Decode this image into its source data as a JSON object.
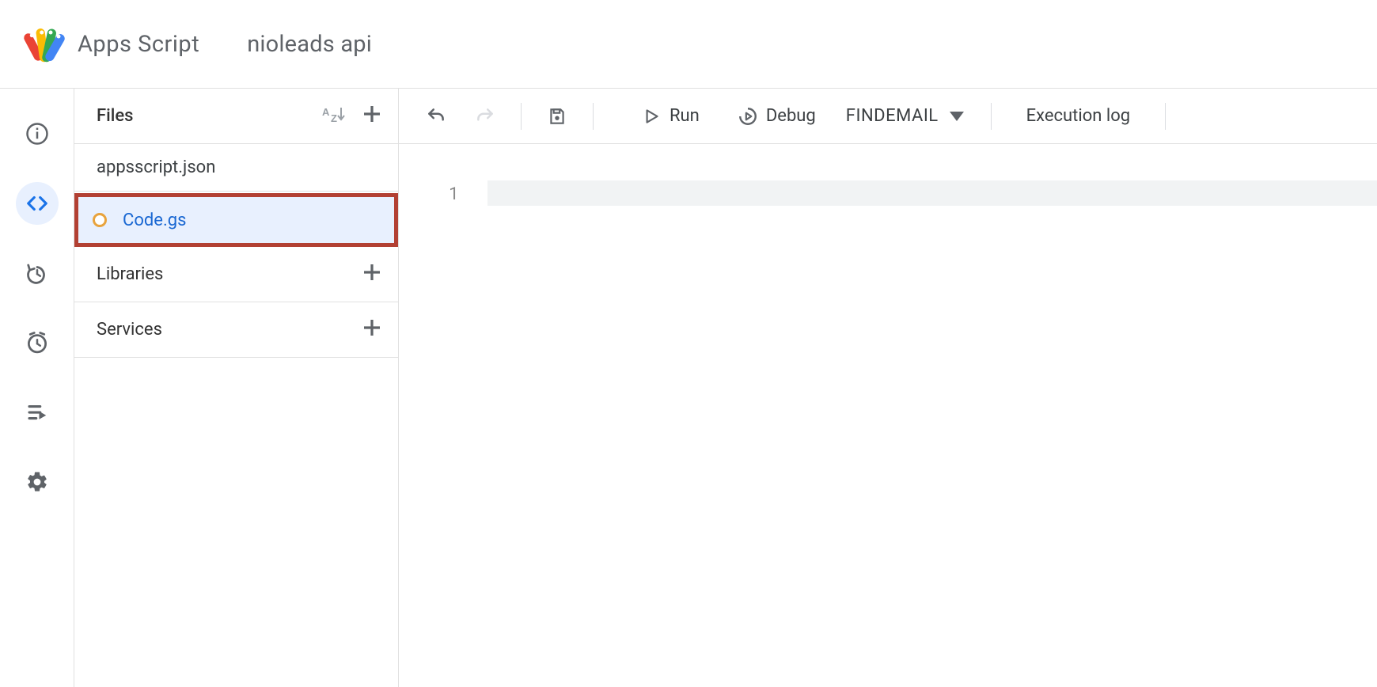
{
  "header": {
    "brand": "Apps Script",
    "project": "nioleads api"
  },
  "filesPanel": {
    "title": "Files",
    "librariesLabel": "Libraries",
    "servicesLabel": "Services",
    "files": [
      {
        "name": "appsscript.json",
        "selected": false
      },
      {
        "name": "Code.gs",
        "selected": true,
        "highlighted": true
      }
    ]
  },
  "toolbar": {
    "run": "Run",
    "debug": "Debug",
    "functionSelected": "FINDEMAIL",
    "executionLog": "Execution log"
  },
  "editor": {
    "lineNumbers": [
      "1"
    ]
  }
}
